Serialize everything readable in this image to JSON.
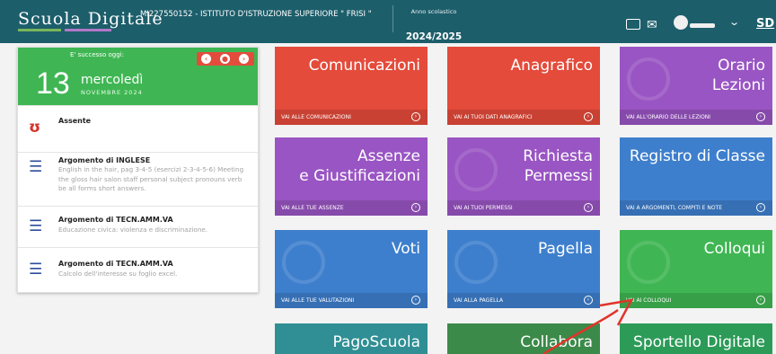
{
  "header": {
    "logo": "Scuola Digitale",
    "school": "MI227550152 - ISTITUTO D'ISTRUZIONE SUPERIORE \" FRISI \"",
    "year_label": "Anno scolastico",
    "year": "2024/2025",
    "right_label": "SD"
  },
  "day_panel": {
    "caption": "E' successo oggi:",
    "day_number": "13",
    "day_name": "mercoledì",
    "month": "NOVEMBRE 2024",
    "controls": [
      "‹",
      "●",
      "›"
    ],
    "events": [
      {
        "icon": "absent-icon",
        "glyph": "ʊ",
        "title": "Assente",
        "desc": ""
      },
      {
        "icon": "list-icon",
        "glyph": "☰",
        "title": "Argomento di INGLESE",
        "desc": "English in the hair, pag 3-4-5 (esercizi 2-3-4-5-6) Meeting the gloss hair salon staff personal subject pronouns verb be all forms short answers."
      },
      {
        "icon": "list-icon",
        "glyph": "☰",
        "title": "Argomento di TECN.AMM.VA",
        "desc": "Educazione civica: violenza e discriminazione."
      },
      {
        "icon": "list-icon",
        "glyph": "☰",
        "title": "Argomento di TECN.AMM.VA",
        "desc": "Calcolo dell'interesse su foglio excel."
      }
    ]
  },
  "tiles": [
    {
      "title": "Comunicazioni",
      "link": "VAI ALLE COMUNICAZIONI",
      "color": "#e44b3b"
    },
    {
      "title": "Anagrafico",
      "link": "VAI AI TUOI DATI ANAGRAFICI",
      "color": "#e44b3b"
    },
    {
      "title": "Orario\nLezioni",
      "link": "VAI ALL'ORARIO DELLE LEZIONI",
      "color": "#9955c3"
    },
    {
      "title": "Assenze\ne Giustificazioni",
      "link": "VAI ALLE TUE ASSENZE",
      "color": "#9955c3"
    },
    {
      "title": "Richiesta\nPermessi",
      "link": "VAI AI TUOI PERMESSI",
      "color": "#9955c3"
    },
    {
      "title": "Registro di Classe",
      "link": "VAI A ARGOMENTI, COMPITI E NOTE",
      "color": "#3e7fcd"
    },
    {
      "title": "Voti",
      "link": "VAI ALLE TUE VALUTAZIONI",
      "color": "#3e7fcd"
    },
    {
      "title": "Pagella",
      "link": "VAI ALLA PAGELLA",
      "color": "#3e7fcd"
    },
    {
      "title": "Colloqui",
      "link": "VAI AI COLLOQUI",
      "color": "#3fb653"
    },
    {
      "title": "PagoScuola",
      "link": "",
      "color": "#2f8f94"
    },
    {
      "title": "Collabora",
      "link": "",
      "color": "#3c8a4a"
    },
    {
      "title": "Sportello Digitale",
      "link": "",
      "color": "#2c9b58"
    }
  ],
  "annotation_color": "#e0342a"
}
